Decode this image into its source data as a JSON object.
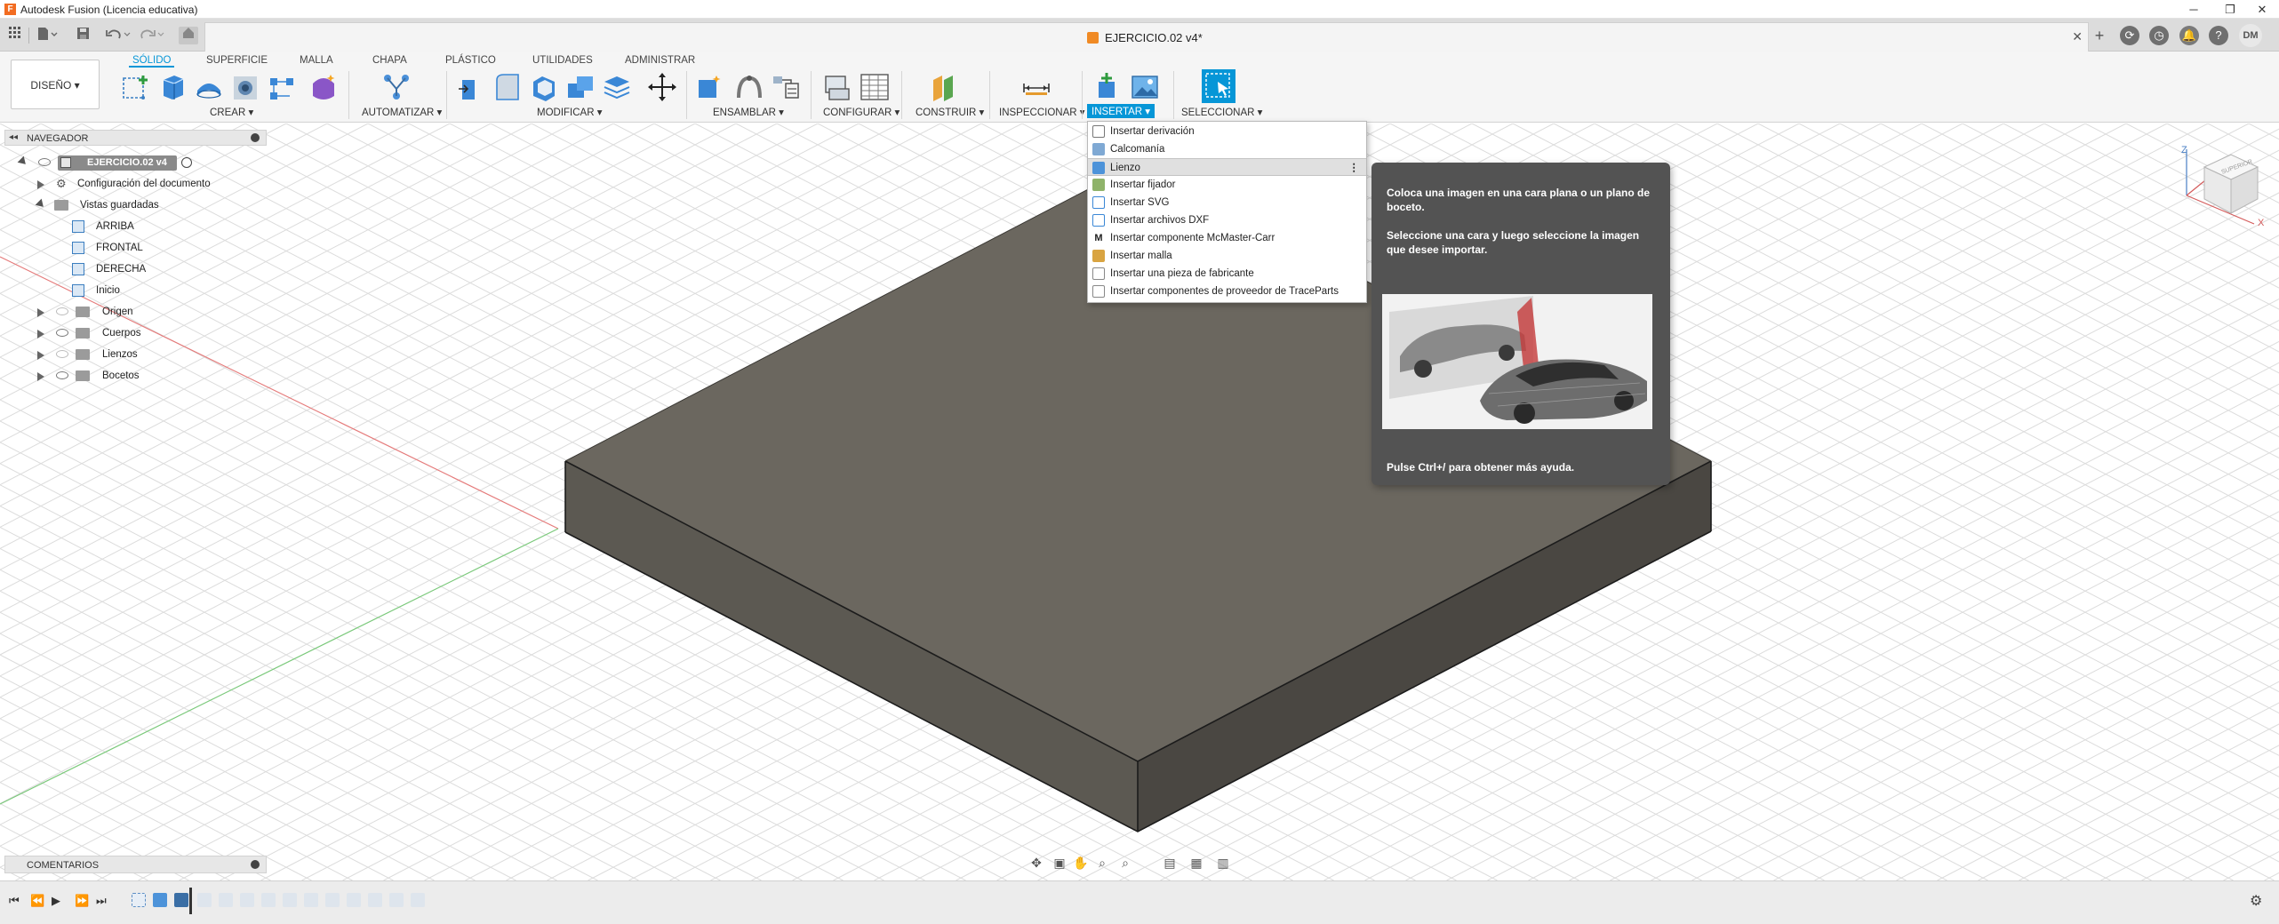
{
  "app": {
    "title": "Autodesk Fusion (Licencia educativa)",
    "logo_letter": "F"
  },
  "window_controls": {
    "minimize": "─",
    "restore": "❐",
    "close": "✕"
  },
  "document_tab": {
    "title": "EJERCICIO.02 v4*",
    "close": "✕"
  },
  "workspace": {
    "label": "DISEÑO ▾"
  },
  "ribbon_tabs": [
    {
      "label": "SÓLIDO",
      "active": true
    },
    {
      "label": "SUPERFICIE"
    },
    {
      "label": "MALLA"
    },
    {
      "label": "CHAPA"
    },
    {
      "label": "PLÁSTICO"
    },
    {
      "label": "UTILIDADES"
    },
    {
      "label": "ADMINISTRAR"
    }
  ],
  "ribbon_groups": [
    {
      "label": "CREAR ▾"
    },
    {
      "label": "AUTOMATIZAR ▾"
    },
    {
      "label": "MODIFICAR ▾"
    },
    {
      "label": "ENSAMBLAR ▾"
    },
    {
      "label": "CONFIGURAR ▾"
    },
    {
      "label": "CONSTRUIR ▾"
    },
    {
      "label": "INSPECCIONAR ▾"
    },
    {
      "label": "INSERTAR ▾",
      "active": true
    },
    {
      "label": "SELECCIONAR ▾"
    }
  ],
  "browser": {
    "header": "NAVEGADOR",
    "root": "EJERCICIO.02 v4",
    "items": [
      {
        "label": "Configuración del documento"
      },
      {
        "label": "Vistas guardadas"
      },
      {
        "label": "ARRIBA"
      },
      {
        "label": "FRONTAL"
      },
      {
        "label": "DERECHA"
      },
      {
        "label": "Inicio"
      },
      {
        "label": "Origen"
      },
      {
        "label": "Cuerpos"
      },
      {
        "label": "Lienzos"
      },
      {
        "label": "Bocetos"
      }
    ]
  },
  "insert_menu": {
    "items": [
      {
        "label": "Insertar derivación",
        "icon": "derive-icon"
      },
      {
        "label": "Calcomanía",
        "icon": "decal-icon"
      },
      {
        "label": "Lienzo",
        "icon": "canvas-icon",
        "highlighted": true,
        "more": "⋮"
      },
      {
        "label": "Insertar fijador",
        "icon": "fastener-icon"
      },
      {
        "label": "Insertar SVG",
        "icon": "svg-icon"
      },
      {
        "label": "Insertar archivos DXF",
        "icon": "dxf-icon"
      },
      {
        "label": "Insertar componente McMaster-Carr",
        "icon": "mcmaster-icon"
      },
      {
        "label": "Insertar malla",
        "icon": "mesh-icon"
      },
      {
        "label": "Insertar una pieza de fabricante",
        "icon": "manufacturer-part-icon"
      },
      {
        "label": "Insertar componentes de proveedor de TraceParts",
        "icon": "traceparts-icon"
      }
    ]
  },
  "tooltip": {
    "line1": "Coloca una imagen en una cara plana o un plano de boceto.",
    "line2": "Seleccione una cara y luego seleccione la imagen que desee importar.",
    "footer": "Pulse Ctrl+/ para obtener más ayuda."
  },
  "comments": {
    "label": "COMENTARIOS"
  },
  "user": {
    "initials": "DM"
  },
  "viewcube": {
    "face_label": "SUPERIOR"
  },
  "colors": {
    "accent": "#0696d7",
    "body_top": "#6e6a63",
    "body_side": "#4f4c47",
    "tooltip_bg": "#535353"
  }
}
